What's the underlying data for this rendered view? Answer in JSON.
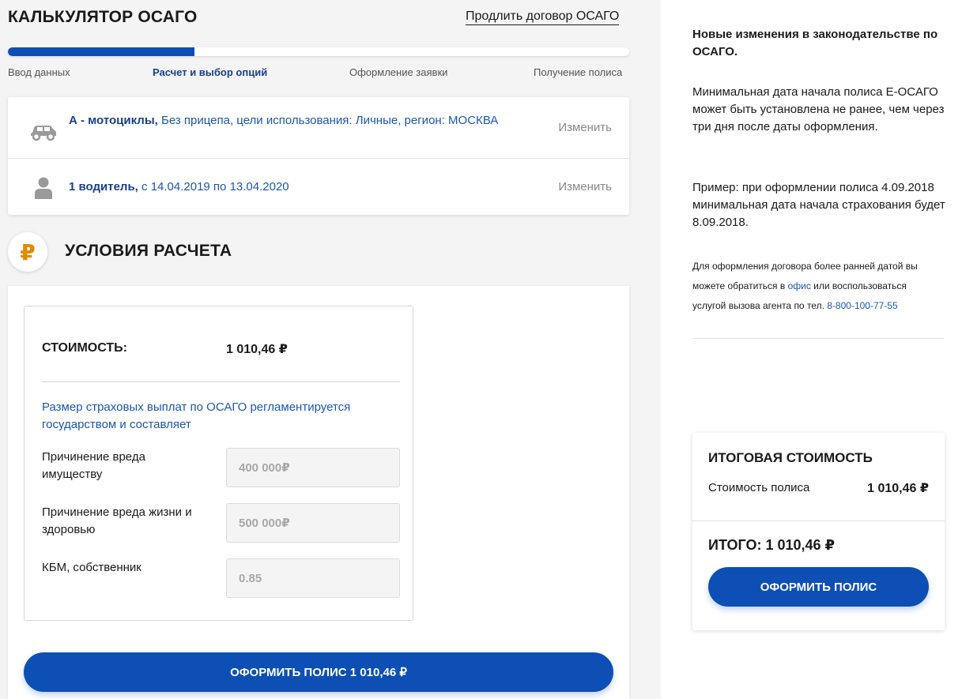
{
  "header": {
    "title": "Калькулятор ОСАГО",
    "renew_link": "Продлить договор ОСАГО"
  },
  "progress": {
    "value_percent": 30,
    "steps": [
      {
        "label": "Ввод данных",
        "active": false
      },
      {
        "label": "Расчет и выбор опций",
        "active": true
      },
      {
        "label": "Оформление заявки",
        "active": false
      },
      {
        "label": "Получение полиса",
        "active": false
      }
    ]
  },
  "summary": {
    "vehicle": {
      "icon": "car-icon",
      "category": "А - мотоциклы,",
      "details": " Без прицепа, цели использования: Личные, регион: МОСКВА",
      "change_label": "Изменить"
    },
    "drivers": {
      "icon": "user-icon",
      "count": "1 водитель,",
      "period": " с 14.04.2019 по 13.04.2020",
      "change_label": "Изменить"
    }
  },
  "conditions": {
    "icon": "ruble-icon",
    "icon_glyph": "₽",
    "title": "Условия расчета",
    "cost_label": "Стоимость:",
    "cost_value": "1 010,46 ₽",
    "note": "Размер страховых выплат по ОСАГО регламентируется государством и составляет",
    "fields": [
      {
        "label": "Причинение вреда имуществу",
        "value": "400 000₽"
      },
      {
        "label": "Причинение вреда жизни и здоровью",
        "value": "500 000₽"
      },
      {
        "label": "КБМ, собственник",
        "value": "0.85"
      }
    ],
    "button_label": "Оформить полис 1 010,46 ₽"
  },
  "sidebar": {
    "heading": "Новые изменения в законодательстве по ОСАГО.",
    "para1": "Минимальная дата начала полиса Е-ОСАГО может быть установлена не ранее, чем через три дня после даты оформления.",
    "para2": "Пример: при оформлении полиса 4.09.2018 минимальная дата начала страхования будет 8.09.2018.",
    "small_part1": "Для оформления договора более ранней датой вы можете обратиться в ",
    "office_link": "офис",
    "small_part2": " или воспользоваться услугой вызова агента по тел. ",
    "phone_link": "8-800-100-77-55"
  },
  "total": {
    "title": "Итоговая стоимость",
    "row_label": "Стоимость полиса",
    "row_value": "1 010,46 ₽",
    "sum": "ИТОГО: 1 010,46 ₽",
    "button_label": "Оформить полис"
  },
  "colors": {
    "accent": "#0d4fb5",
    "link": "#1d56b0",
    "ruble_icon": "#e08a00"
  }
}
